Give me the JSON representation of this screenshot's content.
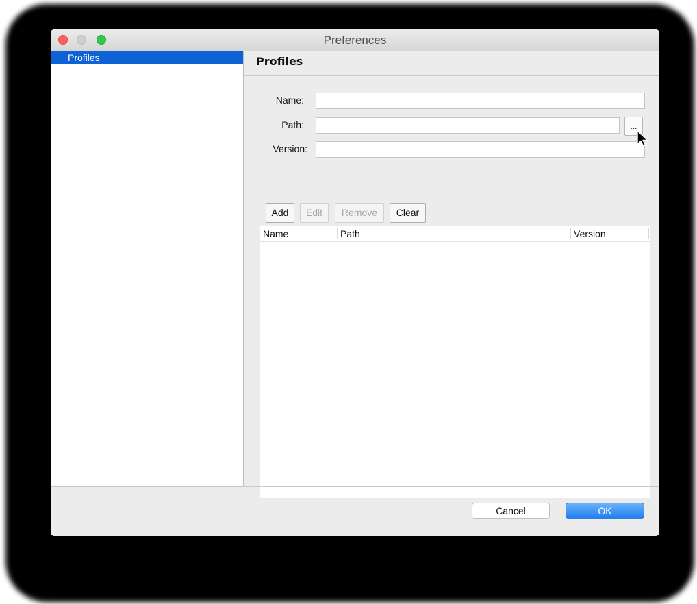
{
  "window": {
    "title": "Preferences"
  },
  "sidebar": {
    "items": [
      {
        "label": "Profiles",
        "selected": true
      }
    ]
  },
  "section": {
    "title": "Profiles"
  },
  "form": {
    "name_label": "Name:",
    "name_value": "",
    "path_label": "Path:",
    "path_value": "",
    "browse_label": "...",
    "version_label": "Version:",
    "version_value": ""
  },
  "actions": {
    "add": "Add",
    "edit": "Edit",
    "remove": "Remove",
    "clear": "Clear"
  },
  "table": {
    "columns": [
      "Name",
      "Path",
      "Version"
    ],
    "rows": []
  },
  "footer": {
    "cancel": "Cancel",
    "ok": "OK"
  },
  "colors": {
    "selection": "#0d63d6",
    "ok_button": "#1f7ef0",
    "close": "#fc605b",
    "maximize": "#34c84a"
  }
}
